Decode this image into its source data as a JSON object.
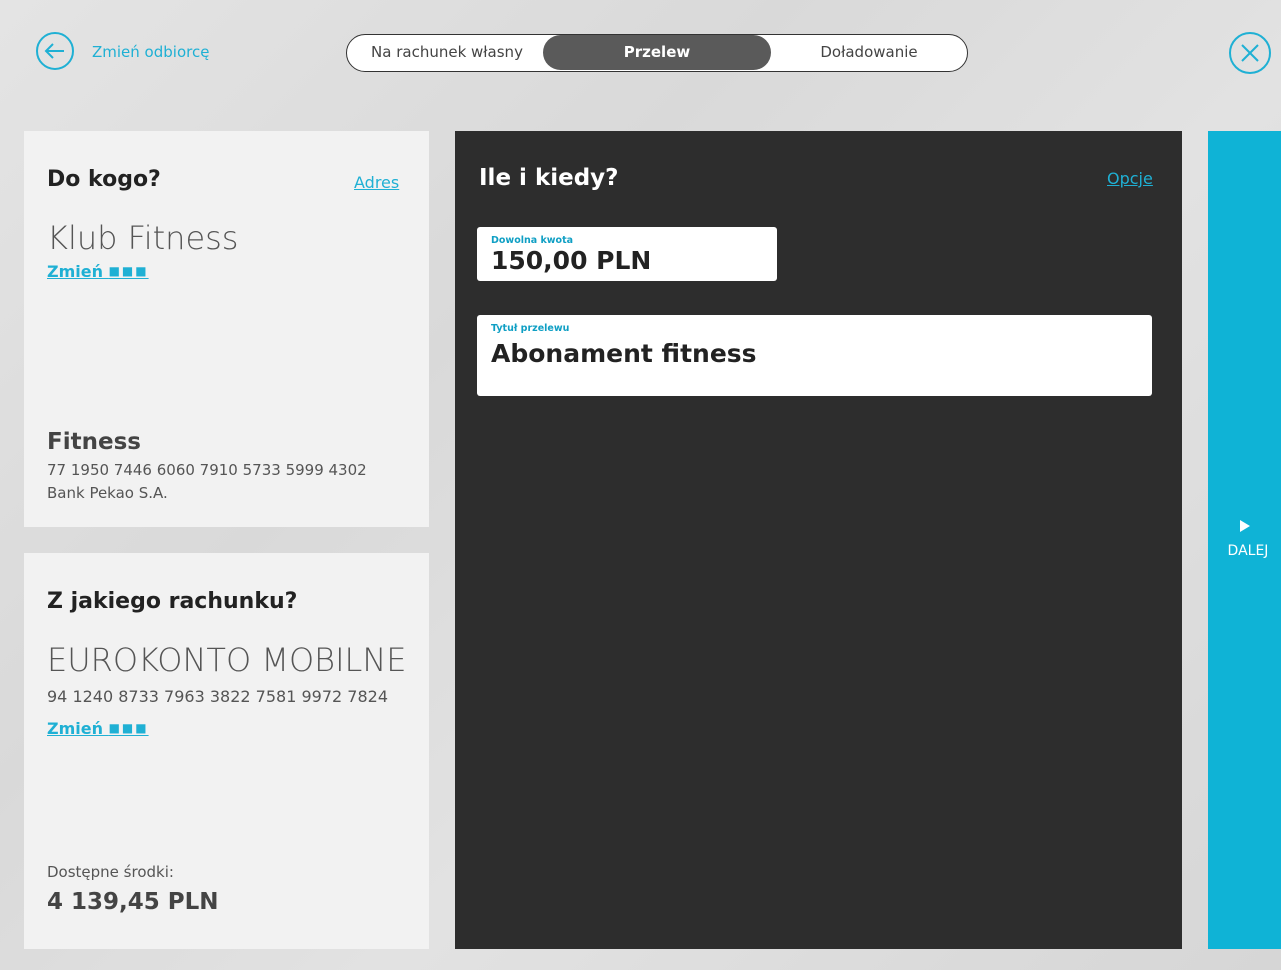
{
  "header": {
    "back_label": "Zmień odbiorcę",
    "tabs": [
      {
        "label": "Na rachunek własny"
      },
      {
        "label": "Przelew",
        "active": true
      },
      {
        "label": "Doładowanie"
      }
    ]
  },
  "recipient": {
    "heading": "Do kogo?",
    "address_link": "Adres",
    "name": "Klub Fitness",
    "change_label": "Zmień",
    "change_dots": "■■■",
    "account_label": "Fitness",
    "account_number": "77 1950 7446 6060 7910 5733 5999 4302",
    "bank": "Bank Pekao S.A."
  },
  "source": {
    "heading": "Z jakiego rachunku?",
    "account_name": "EUROKONTO MOBILNE",
    "account_number": "94 1240 8733 7963 3822 7581 9972 7824",
    "change_label": "Zmień",
    "change_dots": "■■■",
    "available_label": "Dostępne środki:",
    "available_amount": "4 139,45 PLN"
  },
  "transfer": {
    "heading": "Ile i kiedy?",
    "options_link": "Opcje",
    "amount_label": "Dowolna kwota",
    "amount_value": "150,00 PLN",
    "title_label": "Tytuł przelewu",
    "title_value": "Abonament fitness"
  },
  "next": {
    "label": "DALEJ"
  },
  "colors": {
    "accent": "#1fb0d4",
    "panel_dark": "#2d2d2d",
    "next_button": "#0fb3d6"
  }
}
